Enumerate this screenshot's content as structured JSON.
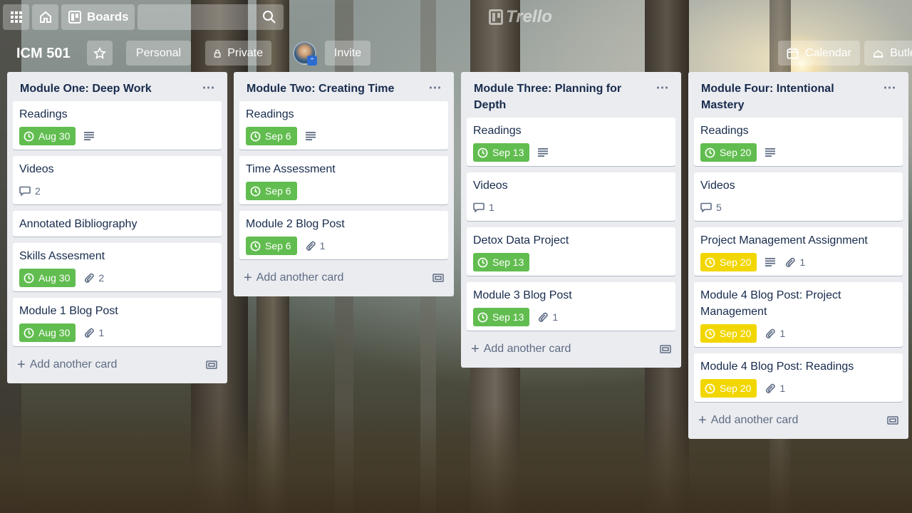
{
  "topbar": {
    "boards_label": "Boards",
    "search_placeholder": "",
    "logo_text": "Trello"
  },
  "board": {
    "title": "ICM 501",
    "personal_label": "Personal",
    "private_label": "Private",
    "invite_label": "Invite",
    "calendar_label": "Calendar",
    "butler_label": "Butler"
  },
  "lists": [
    {
      "title": "Module One: Deep Work",
      "add_label": "Add another card",
      "cards": [
        {
          "title": "Readings",
          "due": "Aug 30",
          "due_color": "green",
          "description": true
        },
        {
          "title": "Videos",
          "comments": "2"
        },
        {
          "title": "Annotated Bibliography"
        },
        {
          "title": "Skills Assesment",
          "due": "Aug 30",
          "due_color": "green",
          "attachments": "2"
        },
        {
          "title": "Module 1 Blog Post",
          "due": "Aug 30",
          "due_color": "green",
          "attachments": "1"
        }
      ]
    },
    {
      "title": "Module Two: Creating Time",
      "add_label": "Add another card",
      "cards": [
        {
          "title": "Readings",
          "due": "Sep 6",
          "due_color": "green",
          "description": true
        },
        {
          "title": "Time Assessment",
          "due": "Sep 6",
          "due_color": "green"
        },
        {
          "title": "Module 2 Blog Post",
          "due": "Sep 6",
          "due_color": "green",
          "attachments": "1"
        }
      ]
    },
    {
      "title": "Module Three: Planning for Depth",
      "add_label": "Add another card",
      "cards": [
        {
          "title": "Readings",
          "due": "Sep 13",
          "due_color": "green",
          "description": true
        },
        {
          "title": "Videos",
          "comments": "1"
        },
        {
          "title": "Detox Data Project",
          "due": "Sep 13",
          "due_color": "green"
        },
        {
          "title": "Module 3 Blog Post",
          "due": "Sep 13",
          "due_color": "green",
          "attachments": "1"
        }
      ]
    },
    {
      "title": "Module Four: Intentional Mastery",
      "add_label": "Add another card",
      "cards": [
        {
          "title": "Readings",
          "due": "Sep 20",
          "due_color": "green",
          "description": true
        },
        {
          "title": "Videos",
          "comments": "5"
        },
        {
          "title": "Project Management Assignment",
          "due": "Sep 20",
          "due_color": "yellow",
          "description": true,
          "attachments": "1"
        },
        {
          "title": "Module 4 Blog Post: Project Management",
          "due": "Sep 20",
          "due_color": "yellow",
          "attachments": "1"
        },
        {
          "title": "Module 4 Blog Post: Readings",
          "due": "Sep 20",
          "due_color": "yellow",
          "attachments": "1"
        }
      ]
    }
  ],
  "colors": {
    "due_green": "#61bd4f",
    "due_yellow": "#f2d600",
    "list_bg": "#ebecf0",
    "text": "#172b4d"
  }
}
